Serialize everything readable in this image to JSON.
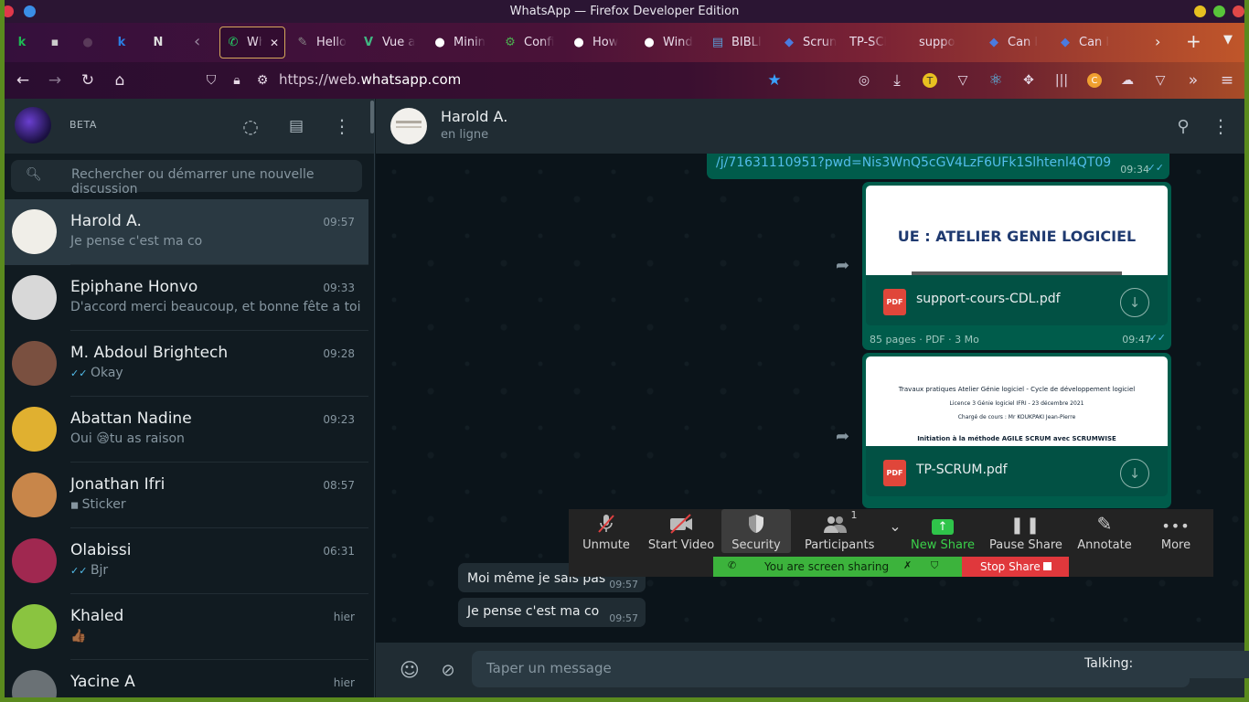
{
  "window": {
    "title": "WhatsApp — Firefox Developer Edition"
  },
  "tabs": [
    {
      "label": "",
      "icon": "green-k-icon",
      "color": "#1db954"
    },
    {
      "label": "",
      "icon": "doc-icon",
      "color": "#cccccc"
    },
    {
      "label": "",
      "icon": "github-icon",
      "color": "#5a3a5a"
    },
    {
      "label": "",
      "icon": "k-icon",
      "color": "#2b7de1"
    },
    {
      "label": "",
      "icon": "notion-icon",
      "color": "#dddddd"
    },
    {
      "label": "Wh",
      "icon": "whatsapp-icon",
      "color": "#25d366",
      "active": true
    },
    {
      "label": "Hello",
      "icon": "note-icon",
      "color": "#888888"
    },
    {
      "label": "Vue a",
      "icon": "vue-icon",
      "color": "#41b883"
    },
    {
      "label": "Minin",
      "icon": "github-icon",
      "color": "#ffffff"
    },
    {
      "label": "Confi",
      "icon": "gear-icon",
      "color": "#4caf50"
    },
    {
      "label": "How",
      "icon": "github-icon",
      "color": "#ffffff"
    },
    {
      "label": "Wind",
      "icon": "github-icon",
      "color": "#ffffff"
    },
    {
      "label": "BIBLI",
      "icon": "library-icon",
      "color": "#5a9bd4"
    },
    {
      "label": "Scrun",
      "icon": "stack-icon",
      "color": "#4a7be0"
    },
    {
      "label": "TP-SCRU",
      "icon": "",
      "color": ""
    },
    {
      "label": "support-",
      "icon": "",
      "color": ""
    },
    {
      "label": "Can I",
      "icon": "stack-icon",
      "color": "#4a7be0"
    },
    {
      "label": "Can I",
      "icon": "stack-icon",
      "color": "#4a7be0"
    }
  ],
  "navbar": {
    "url_prefix": "https://web.",
    "url_domain": "whatsapp.com"
  },
  "sidebar": {
    "beta": "BETA",
    "search_placeholder": "Rechercher ou démarrer une nouvelle discussion",
    "chats": [
      {
        "name": "Harold A.",
        "time": "09:57",
        "preview": "Je pense c'est ma co",
        "selected": true,
        "avatar_color": "#f0eee8"
      },
      {
        "name": "Epiphane Honvo",
        "time": "09:33",
        "preview": "D'accord merci beaucoup, et bonne fête a toi",
        "avatar_color": "#d8d8d8"
      },
      {
        "name": "M. Abdoul Brightech",
        "time": "09:28",
        "preview": "Okay",
        "ticks": true,
        "avatar_color": "#7a5040"
      },
      {
        "name": "Abattan Nadine",
        "time": "09:23",
        "preview": "Oui 😪tu as raison",
        "avatar_color": "#e0b030"
      },
      {
        "name": "Jonathan Ifri",
        "time": "08:57",
        "preview": "Sticker",
        "sticker": true,
        "avatar_color": "#c8864a"
      },
      {
        "name": "Olabissi",
        "time": "06:31",
        "preview": "Bjr",
        "ticks": true,
        "avatar_color": "#a02850"
      },
      {
        "name": "Khaled",
        "time": "hier",
        "preview": "👍🏾",
        "avatar_color": "#8ac440"
      },
      {
        "name": "Yacine A",
        "time": "hier",
        "preview": "",
        "avatar_color": "#6a7175"
      }
    ]
  },
  "conversation": {
    "name": "Harold A.",
    "status": "en ligne",
    "link_text": "/j/71631110951?pwd=Nis3WnQ5cGV4LzF6UFk1Slhtenl4QT09",
    "link_time": "09:34",
    "doc1": {
      "preview_title": "UE : ATELIER GENIE LOGICIEL",
      "name": "support-cours-CDL.pdf",
      "meta": "85 pages · PDF · 3 Mo",
      "time": "09:47"
    },
    "doc2": {
      "preview_lines": [
        "Travaux pratiques Atelier Génie logiciel - Cycle de développement logiciel",
        "Licence 3 Génie logiciel IFRI - 23 décembre 2021",
        "Chargé de cours : Mr KOUKPAKI Jean-Pierre",
        "Initiation à la méthode AGILE SCRUM avec SCRUMWISE"
      ],
      "name": "TP-SCRUM.pdf"
    },
    "in_messages": [
      {
        "text": "Moi même je sais pas",
        "time": "09:57"
      },
      {
        "text": "Je pense c'est ma co",
        "time": "09:57"
      }
    ],
    "composer_placeholder": "Taper un message",
    "pdf_label": "PDF"
  },
  "zoom": {
    "buttons": [
      {
        "label": "Unmute",
        "icon": "muted-mic-icon"
      },
      {
        "label": "Start Video",
        "icon": "video-off-icon"
      },
      {
        "label": "Security",
        "icon": "shield-icon"
      },
      {
        "label": "Participants",
        "icon": "participants-icon",
        "count": "1"
      },
      {
        "label": "New Share",
        "icon": "share-up-icon"
      },
      {
        "label": "Pause Share",
        "icon": "pause-icon"
      },
      {
        "label": "Annotate",
        "icon": "pencil-icon"
      },
      {
        "label": "More",
        "icon": "more-dots-icon"
      }
    ],
    "sharing_text": "You are screen sharing",
    "stop_share": "Stop Share",
    "talking": "Talking:"
  }
}
